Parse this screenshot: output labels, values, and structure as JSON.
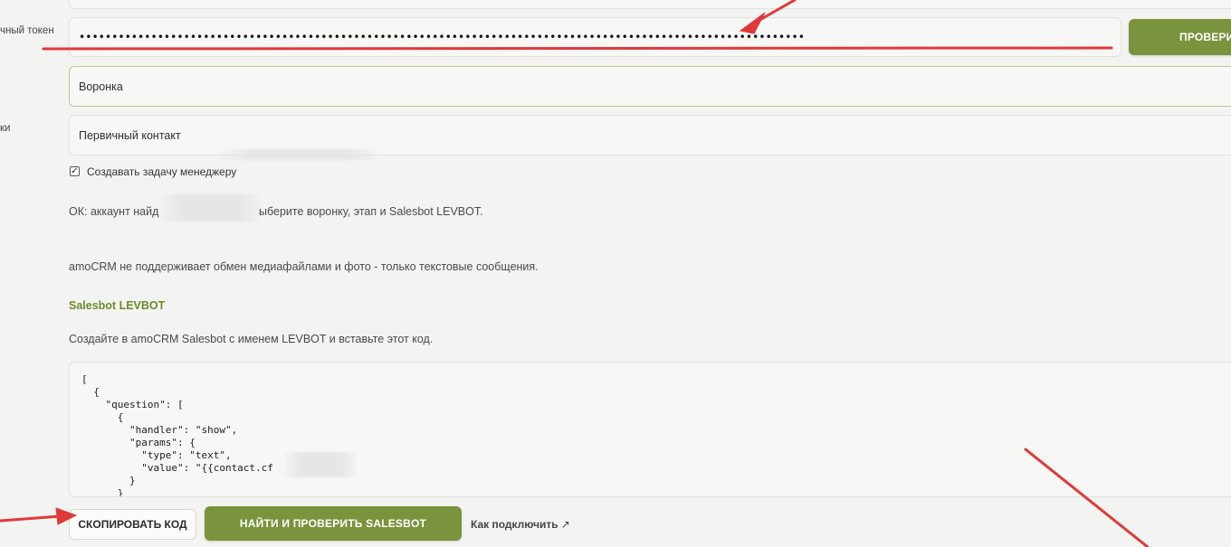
{
  "form": {
    "token_label": "чный токен",
    "token_value": "•••••••••••••••••••••••••••••••••••••••••••••••••••••••••••••••••••••••••••••••••••••••••••••••••••••••••••••••",
    "check_button": "ПРОВЕРИ",
    "pipeline_value": "Воронка",
    "stage_label": "ки",
    "stage_value": "Первичный контакт",
    "task_checkbox_label": "Создавать задачу менеджеру",
    "task_checkbox_checked": true,
    "status_prefix": "ОК: аккаунт найд",
    "status_suffix": "ыберите воронку, этап и Salesbot LEVBOT.",
    "media_notice": "amoCRM не поддерживает обмен медиафайлами и фото - только текстовые сообщения."
  },
  "salesbot": {
    "heading": "Salesbot LEVBOT",
    "instruction": "Создайте в amoCRM Salesbot с именем LEVBOT и вставьте этот код.",
    "code": "[\n  {\n    \"question\": [\n      {\n        \"handler\": \"show\",\n        \"params\": {\n          \"type\": \"text\",\n          \"value\": \"{{contact.cf\n        }\n      }",
    "copy_button": "СКОПИРОВАТЬ КОД",
    "find_button": "НАЙТИ И ПРОВЕРИТЬ SALESBOT",
    "howto_link": "Как подключить",
    "howto_icon": "arrow-up-right-icon"
  },
  "colors": {
    "accent_green": "#7a933c",
    "heading_green": "#6c8a2a",
    "annotation_red": "#e0393a"
  }
}
